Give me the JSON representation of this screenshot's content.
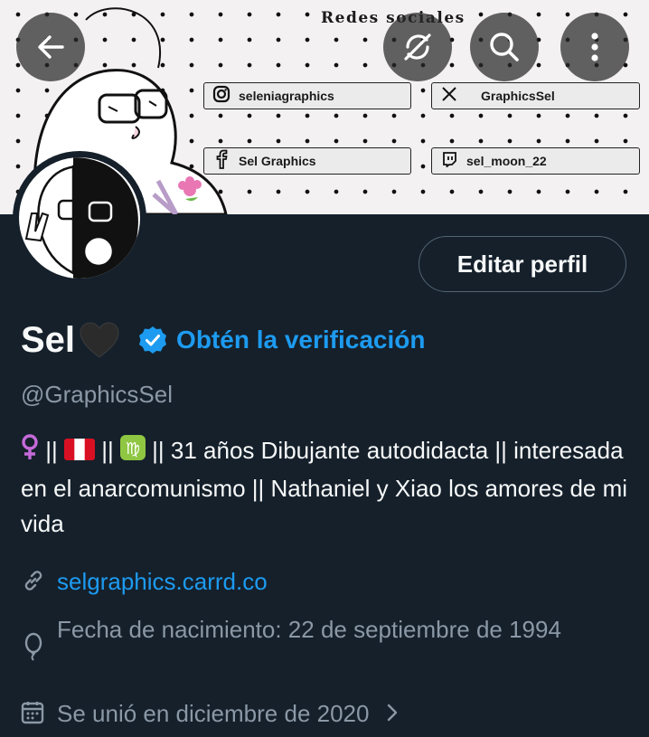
{
  "banner": {
    "title": "Redes sociales",
    "socials": [
      {
        "icon": "instagram-icon",
        "handle": "seleniagraphics"
      },
      {
        "icon": "x-icon",
        "handle": "GraphicsSel"
      },
      {
        "icon": "facebook-icon",
        "handle": "Sel Graphics"
      },
      {
        "icon": "twitch-icon",
        "handle": "sel_moon_22"
      }
    ]
  },
  "toolbar": {
    "back_icon": "back-arrow-icon",
    "norefresh_icon": "refresh-off-icon",
    "search_icon": "search-icon",
    "more_icon": "more-vertical-icon"
  },
  "profile": {
    "edit_label": "Editar perfil",
    "name": "Sel",
    "verify_label": "Obtén la verificación",
    "handle": "@GraphicsSel",
    "bio": {
      "segment1": " || ",
      "segment2": " || ",
      "segment3": " || 31 años Dibujante autodidacta || interesada en el anarcomunismo || Nathaniel y Xiao los amores de mi vida"
    },
    "link": "selgraphics.carrd.co",
    "birth": "Fecha de nacimiento: 22 de septiembre de 1994",
    "joined": "Se unió en diciembre de 2020"
  },
  "colors": {
    "background": "#15202b",
    "accent": "#1d9bf0",
    "muted": "#8b98a5",
    "text": "#f7f9f9"
  }
}
